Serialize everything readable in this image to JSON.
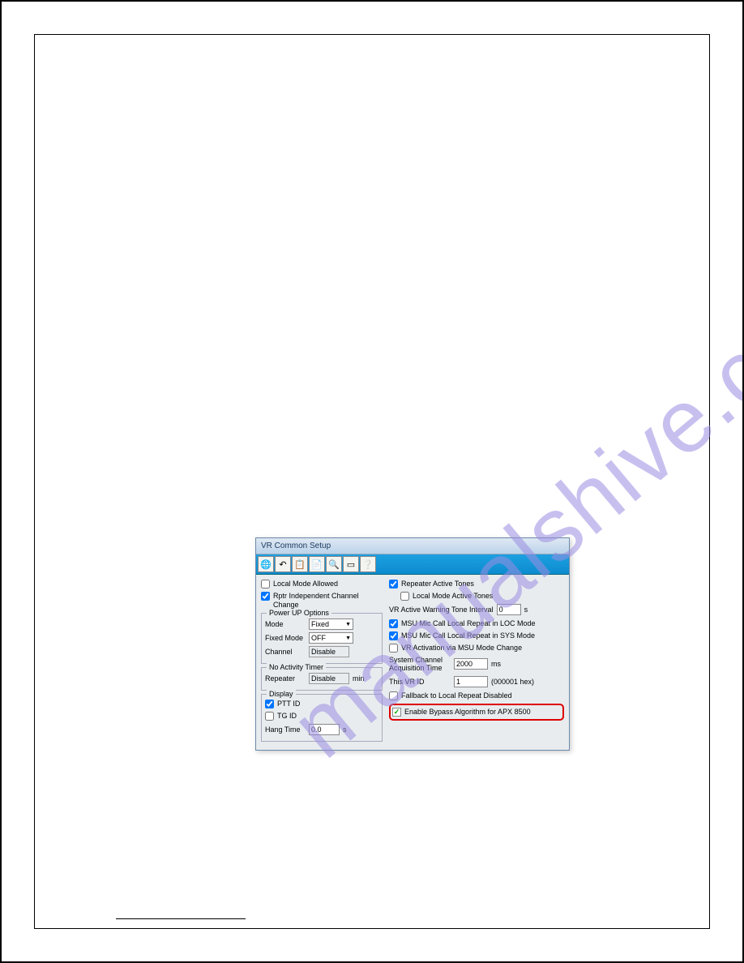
{
  "watermark": "manualshive.com",
  "dialog": {
    "title": "VR Common Setup",
    "toolbar_icons": [
      "globe-icon",
      "undo-icon",
      "copy-icon",
      "paste-icon",
      "zoom-icon",
      "window-icon",
      "help-icon"
    ],
    "left": {
      "local_mode_allowed": "Local Mode Allowed",
      "rptr_indep": "Rptr Independent Channel Change",
      "power_up": {
        "legend": "Power UP Options",
        "mode_label": "Mode",
        "mode_value": "Fixed",
        "fixed_mode_label": "Fixed Mode",
        "fixed_mode_value": "OFF",
        "channel_label": "Channel",
        "channel_value": "Disable"
      },
      "no_activity": {
        "legend": "No Activity Timer",
        "repeater_label": "Repeater",
        "repeater_value": "Disable",
        "repeater_unit": "min"
      },
      "display": {
        "legend": "Display",
        "ptt_id": "PTT ID",
        "tg_id": "TG ID",
        "hang_time_label": "Hang Time",
        "hang_time_value": "0.0",
        "hang_time_unit": "s"
      }
    },
    "right": {
      "repeater_active_tones": "Repeater Active Tones",
      "local_mode_active_tones": "Local Mode Active Tones",
      "vr_active_warning_label": "VR Active Warning Tone Interval",
      "vr_active_warning_value": "0",
      "vr_active_warning_unit": "s",
      "msu_mic_loc": "MSU Mic Call Local Repeat in LOC Mode",
      "msu_mic_sys": "MSU Mic Call Local Repeat in SYS Mode",
      "vr_activation": "VR Activation via MSU Mode Change",
      "sys_channel_label": "System Channel Acquisition Time",
      "sys_channel_value": "2000",
      "sys_channel_unit": "ms",
      "this_vr_id_label": "This VR ID",
      "this_vr_id_value": "1",
      "this_vr_id_hex": "(000001 hex)",
      "fallback": "Fallback to Local Repeat Disabled",
      "enable_bypass": "Enable Bypass Algorithm for APX 8500"
    }
  }
}
